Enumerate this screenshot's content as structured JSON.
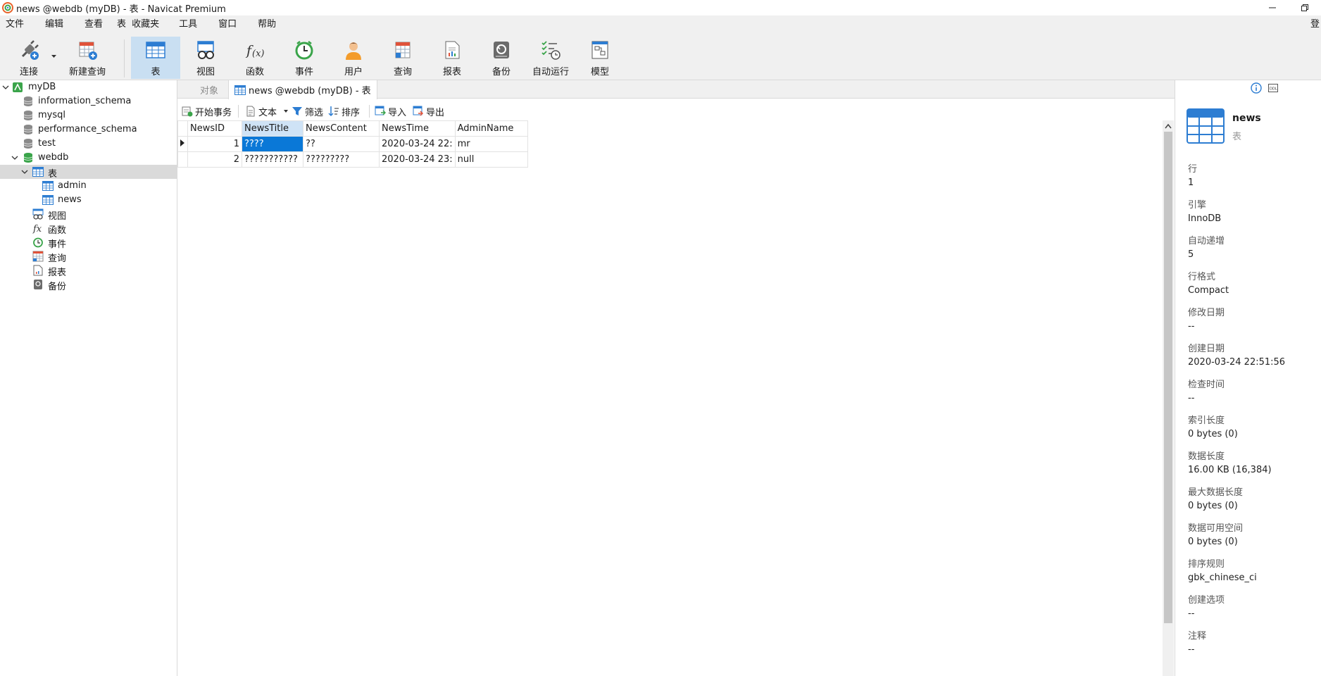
{
  "window": {
    "title": "news @webdb (myDB) - 表 - Navicat Premium",
    "login_label": "登"
  },
  "menu": [
    "文件",
    "编辑",
    "查看",
    "表",
    "收藏夹",
    "工具",
    "窗口",
    "帮助"
  ],
  "toolbar": {
    "connect": "连接",
    "new_query": "新建查询",
    "table": "表",
    "view": "视图",
    "function": "函数",
    "event": "事件",
    "user": "用户",
    "query": "查询",
    "report": "报表",
    "backup": "备份",
    "auto_run": "自动运行",
    "model": "模型"
  },
  "tree": {
    "connection": "myDB",
    "databases": [
      "information_schema",
      "mysql",
      "performance_schema",
      "test",
      "webdb"
    ],
    "tables_node": "表",
    "tables": [
      "admin",
      "news"
    ],
    "views": "视图",
    "functions": "函数",
    "events": "事件",
    "queries": "查询",
    "reports": "报表",
    "backups": "备份"
  },
  "tabs": {
    "objects": "对象",
    "current": "news @webdb (myDB) - 表"
  },
  "subtoolbar": {
    "begin_transaction": "开始事务",
    "text": "文本",
    "filter": "筛选",
    "sort": "排序",
    "import": "导入",
    "export": "导出"
  },
  "grid": {
    "columns": [
      "NewsID",
      "NewsTitle",
      "NewsContent",
      "NewsTime",
      "AdminName"
    ],
    "rows": [
      [
        "1",
        "????",
        "??",
        "2020-03-24 22:",
        "mr"
      ],
      [
        "2",
        "???????????",
        "?????????",
        "2020-03-24 23:",
        "null"
      ]
    ]
  },
  "info": {
    "name": "news",
    "type": "表",
    "props": [
      {
        "k": "行",
        "v": "1"
      },
      {
        "k": "引擎",
        "v": "InnoDB"
      },
      {
        "k": "自动递增",
        "v": "5"
      },
      {
        "k": "行格式",
        "v": "Compact"
      },
      {
        "k": "修改日期",
        "v": "--"
      },
      {
        "k": "创建日期",
        "v": "2020-03-24 22:51:56"
      },
      {
        "k": "检查时间",
        "v": "--"
      },
      {
        "k": "索引长度",
        "v": "0 bytes (0)"
      },
      {
        "k": "数据长度",
        "v": "16.00 KB (16,384)"
      },
      {
        "k": "最大数据长度",
        "v": "0 bytes (0)"
      },
      {
        "k": "数据可用空间",
        "v": "0 bytes (0)"
      },
      {
        "k": "排序规则",
        "v": "gbk_chinese_ci"
      },
      {
        "k": "创建选项",
        "v": "--"
      },
      {
        "k": "注释",
        "v": "--"
      }
    ]
  },
  "colors": {
    "selection": "#0a78d7",
    "toolbar_active": "#c9dff2",
    "tree_selected": "#dadada"
  }
}
